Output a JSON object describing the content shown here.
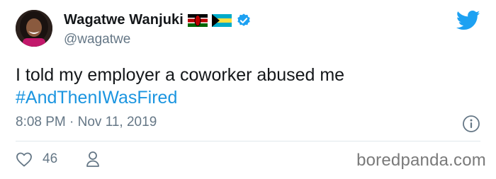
{
  "tweet": {
    "author_name": "Wagatwe Wanjuki",
    "handle": "@wagatwe",
    "text": "I told my employer a coworker abused me",
    "hashtag": "#AndThenIWasFired",
    "timestamp": "8:08 PM · Nov 11, 2019",
    "like_count": "46"
  },
  "icons": {
    "flags": [
      "kenya-flag-icon",
      "bahamas-flag-icon"
    ],
    "verified": "verified-badge-icon",
    "brand": "twitter-bird-icon",
    "info": "info-icon",
    "like": "heart-icon",
    "profile": "person-icon"
  },
  "watermark": "boredpanda.com",
  "colors": {
    "link": "#1b95e0",
    "secondary_text": "#657786",
    "twitter_blue": "#1da1f2"
  }
}
